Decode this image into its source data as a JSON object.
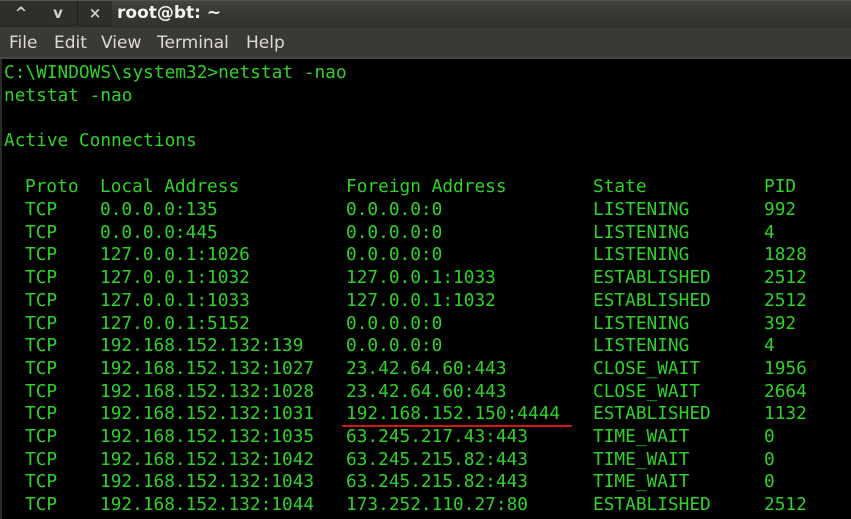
{
  "window": {
    "title": "root@bt: ~",
    "controls": [
      {
        "name": "minimize",
        "glyph": "^"
      },
      {
        "name": "maximize",
        "glyph": "v"
      },
      {
        "name": "close",
        "glyph": "×"
      }
    ]
  },
  "menubar": {
    "items": [
      "File",
      "Edit",
      "View",
      "Terminal",
      "Help"
    ]
  },
  "terminal": {
    "text_color": "#2fd12a",
    "highlight_color": "#d01818",
    "prompt_line": "C:\\WINDOWS\\system32>netstat -nao",
    "echo_line": "netstat -nao",
    "section_title": "Active Connections",
    "table": {
      "headers": [
        "Proto",
        "Local Address",
        "Foreign Address",
        "State",
        "PID"
      ],
      "rows": [
        [
          "TCP",
          "0.0.0.0:135",
          "0.0.0.0:0",
          "LISTENING",
          "992"
        ],
        [
          "TCP",
          "0.0.0.0:445",
          "0.0.0.0:0",
          "LISTENING",
          "4"
        ],
        [
          "TCP",
          "127.0.0.1:1026",
          "0.0.0.0:0",
          "LISTENING",
          "1828"
        ],
        [
          "TCP",
          "127.0.0.1:1032",
          "127.0.0.1:1033",
          "ESTABLISHED",
          "2512"
        ],
        [
          "TCP",
          "127.0.0.1:1033",
          "127.0.0.1:1032",
          "ESTABLISHED",
          "2512"
        ],
        [
          "TCP",
          "127.0.0.1:5152",
          "0.0.0.0:0",
          "LISTENING",
          "392"
        ],
        [
          "TCP",
          "192.168.152.132:139",
          "0.0.0.0:0",
          "LISTENING",
          "4"
        ],
        [
          "TCP",
          "192.168.152.132:1027",
          "23.42.64.60:443",
          "CLOSE_WAIT",
          "1956"
        ],
        [
          "TCP",
          "192.168.152.132:1028",
          "23.42.64.60:443",
          "CLOSE_WAIT",
          "2664"
        ],
        [
          "TCP",
          "192.168.152.132:1031",
          "192.168.152.150:4444",
          "ESTABLISHED",
          "1132"
        ],
        [
          "TCP",
          "192.168.152.132:1035",
          "63.245.217.43:443",
          "TIME_WAIT",
          "0"
        ],
        [
          "TCP",
          "192.168.152.132:1042",
          "63.245.215.82:443",
          "TIME_WAIT",
          "0"
        ],
        [
          "TCP",
          "192.168.152.132:1043",
          "63.245.215.82:443",
          "TIME_WAIT",
          "0"
        ],
        [
          "TCP",
          "192.168.152.132:1044",
          "173.252.110.27:80",
          "ESTABLISHED",
          "2512"
        ]
      ],
      "highlighted_row": 9,
      "highlighted_column": "Foreign Address"
    }
  }
}
